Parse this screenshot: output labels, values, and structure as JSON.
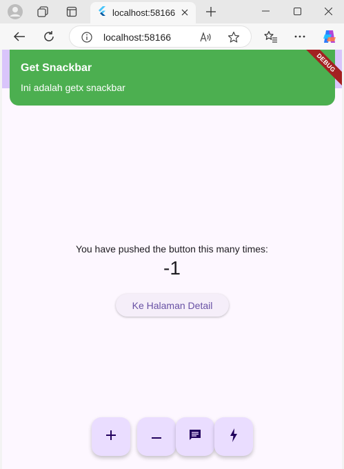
{
  "browser": {
    "tab_title": "localhost:58166",
    "url": "localhost:58166"
  },
  "app": {
    "snackbar": {
      "title": "Get Snackbar",
      "message": "Ini adalah getx snackbar",
      "color": "#4caf50"
    },
    "debug_banner": "DEBUG",
    "counter_label": "You have pushed the button this many times:",
    "counter_value": "-1",
    "detail_button": "Ke Halaman Detail",
    "fabs": [
      {
        "icon": "plus-icon"
      },
      {
        "icon": "minus-icon"
      },
      {
        "icon": "message-icon"
      },
      {
        "icon": "lightning-icon"
      }
    ],
    "accent": "#6750a4",
    "background": "#fdf7ff"
  }
}
